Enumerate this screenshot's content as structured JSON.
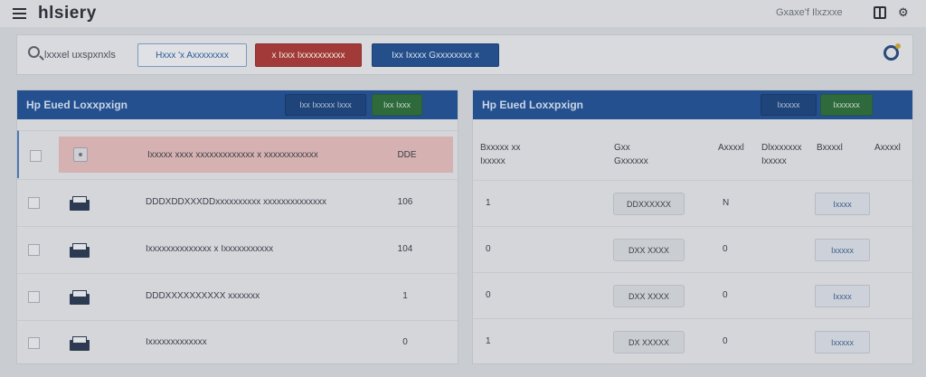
{
  "app": {
    "title": "hlsiery",
    "top_right_text": "Gxaxe'f Ilxzxxe"
  },
  "toolbar": {
    "search_placeholder": "lxxxel uxspxnxls",
    "outline_button": "Hxxx 'x Axxxxxxxx",
    "red_button": "x Ixxx Ixxxxxxxxxx",
    "blue_button": "Ixx Ixxxx Gxxxxxxxx x"
  },
  "left_panel": {
    "title": "Hp Eued Loxxpxign",
    "header_button_navy": "Ixx Ixxxxx Ixxx",
    "header_button_green": "Ixx Ixxx",
    "rows": [
      {
        "text": "Ixxxxx xxxx xxxxxxxxxxxxx x xxxxxxxxxxxx",
        "count": "DDE",
        "selected": true
      },
      {
        "text": "DDDXDDXXXDDxxxxxxxxxx xxxxxxxxxxxxxx",
        "count": "106",
        "selected": false
      },
      {
        "text": "Ixxxxxxxxxxxxxx x Ixxxxxxxxxxx",
        "count": "104",
        "selected": false
      },
      {
        "text": "DDDXXXXXXXXXX xxxxxxx",
        "count": "1",
        "selected": false
      },
      {
        "text": "Ixxxxxxxxxxxxx",
        "count": "0",
        "selected": false
      }
    ]
  },
  "right_panel": {
    "title": "Hp Eued Loxxpxign",
    "header_button_navy": "Ixxxxx",
    "header_button_green": "Ixxxxxx",
    "columns": [
      {
        "line1": "Bxxxxx xx",
        "line2": "Ixxxxx"
      },
      {
        "line1": "Gxx",
        "line2": "Gxxxxxx"
      },
      {
        "line1": "Axxxxl",
        "line2": ""
      },
      {
        "line1": "Dlxxxxxxx",
        "line2": "Ixxxxx"
      },
      {
        "line1": "Bxxxxl",
        "line2": ""
      },
      {
        "line1": "Axxxxl",
        "line2": ""
      }
    ],
    "rows": [
      {
        "count": "1",
        "pill": "DDXXXXXX",
        "amount": "N",
        "button": "Ixxxx"
      },
      {
        "count": "0",
        "pill": "DXX XXXX",
        "amount": "0",
        "button": "Ixxxxx"
      },
      {
        "count": "0",
        "pill": "DXX XXXX",
        "amount": "0",
        "button": "Ixxxx"
      },
      {
        "count": "1",
        "pill": "DX XXXXX",
        "amount": "0",
        "button": "Ixxxxx"
      }
    ]
  }
}
